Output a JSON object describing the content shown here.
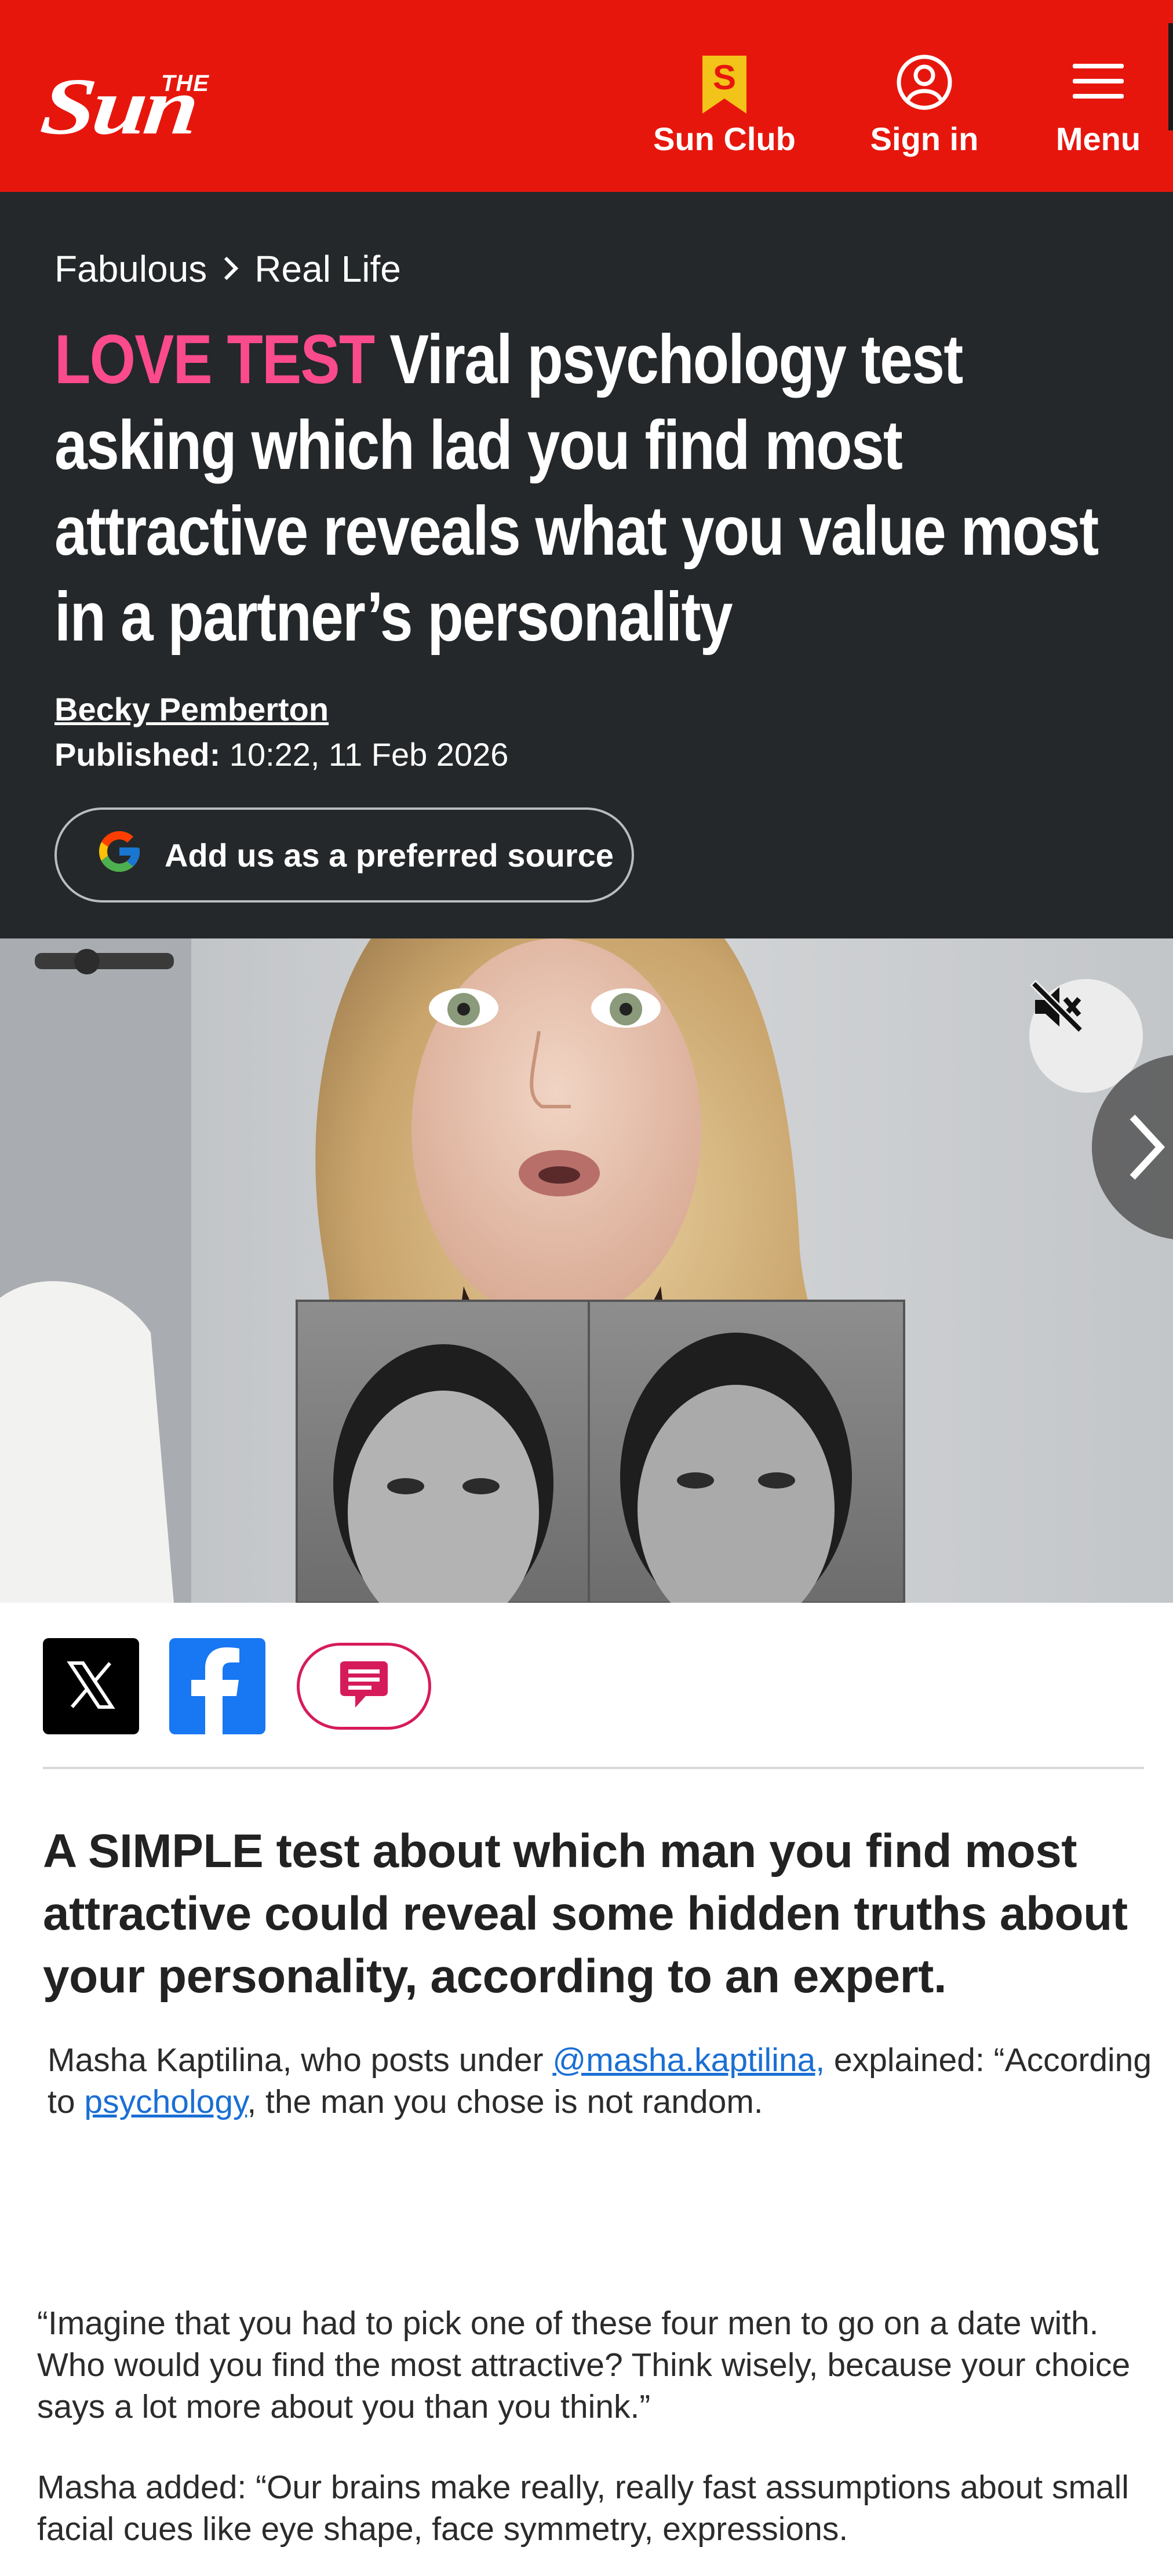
{
  "header": {
    "logo_small": "THE",
    "logo_word": "Sun",
    "nav": {
      "sun_club": "Sun Club",
      "sign_in": "Sign in",
      "menu": "Menu"
    }
  },
  "article": {
    "breadcrumb": [
      "Fabulous",
      "Real Life"
    ],
    "kicker": "LOVE TEST",
    "headline": "Viral psychology test asking which lad you find most attractive reveals what you value most in a partner’s personality",
    "author": "Becky Pemberton",
    "published_label": "Published:",
    "published_value": "10:22, 11 Feb 2026",
    "preferred_source_label": "Add us as a preferred source",
    "standfirst": "A SIMPLE test about which man you find most attractive could reveal some hidden truths about your personality, according to an expert.",
    "p1": {
      "t1": "Masha Kaptilina, who posts under ",
      "link1": "@masha.kaptilina,",
      "t2": " explained: “According to ",
      "link2": "psychology",
      "t3": ", the man you chose is not random."
    },
    "p2": "“Imagine that you had to pick one of these four men to go on a date with. Who would you find the most attractive? Think wisely, because your choice says a lot more about you than you think.”",
    "p3": "Masha added: “Our brains make really, really fast assumptions about small facial cues like eye shape, face symmetry, expressions."
  },
  "colors": {
    "brand_red": "#e7160d",
    "dark_header": "#24282a",
    "kicker_pink": "#fb4b8d",
    "link_blue": "#1a6fd4",
    "facebook_blue": "#1877f2",
    "comment_pink": "#d61b5b"
  },
  "icons": [
    "sun-club-badge-icon",
    "user-circle-icon",
    "hamburger-menu-icon",
    "chevron-right-icon",
    "google-g-icon",
    "mute-icon",
    "x-logo-icon",
    "facebook-logo-icon",
    "comment-icon"
  ]
}
